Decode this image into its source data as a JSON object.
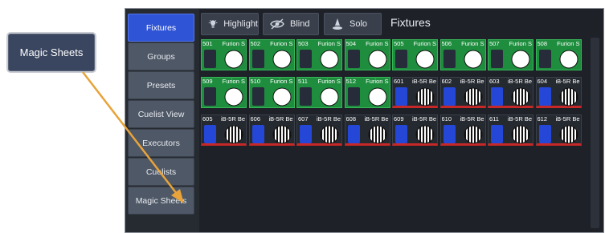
{
  "callout": {
    "label": "Magic Sheets"
  },
  "sidebar": {
    "items": [
      {
        "label": "Fixtures",
        "active": true
      },
      {
        "label": "Groups"
      },
      {
        "label": "Presets"
      },
      {
        "label": "Cuelist View"
      },
      {
        "label": "Executors"
      },
      {
        "label": "Cuelists"
      },
      {
        "label": "Magic Sheets"
      }
    ]
  },
  "toolbar": {
    "highlight_label": "Highlight",
    "blind_label": "Blind",
    "solo_label": "Solo",
    "title": "Fixtures"
  },
  "fixtures": [
    {
      "id": "501",
      "name": "Furion S",
      "type": "furion"
    },
    {
      "id": "502",
      "name": "Furion S",
      "type": "furion"
    },
    {
      "id": "503",
      "name": "Furion S",
      "type": "furion"
    },
    {
      "id": "504",
      "name": "Furion S",
      "type": "furion"
    },
    {
      "id": "505",
      "name": "Furion S",
      "type": "furion"
    },
    {
      "id": "506",
      "name": "Furion S",
      "type": "furion"
    },
    {
      "id": "507",
      "name": "Furion S",
      "type": "furion"
    },
    {
      "id": "508",
      "name": "Furion S",
      "type": "furion"
    },
    {
      "id": "509",
      "name": "Furion S",
      "type": "furion"
    },
    {
      "id": "510",
      "name": "Furion S",
      "type": "furion"
    },
    {
      "id": "511",
      "name": "Furion S",
      "type": "furion"
    },
    {
      "id": "512",
      "name": "Furion S",
      "type": "furion"
    },
    {
      "id": "601",
      "name": "iB-5R Be",
      "type": "ib"
    },
    {
      "id": "602",
      "name": "iB-5R Be",
      "type": "ib"
    },
    {
      "id": "603",
      "name": "iB-5R Be",
      "type": "ib"
    },
    {
      "id": "604",
      "name": "iB-5R Be",
      "type": "ib"
    },
    {
      "id": "605",
      "name": "iB-5R Be",
      "type": "ib"
    },
    {
      "id": "606",
      "name": "iB-5R Be",
      "type": "ib"
    },
    {
      "id": "607",
      "name": "iB-5R Be",
      "type": "ib"
    },
    {
      "id": "608",
      "name": "iB-5R Be",
      "type": "ib"
    },
    {
      "id": "609",
      "name": "iB-5R Be",
      "type": "ib"
    },
    {
      "id": "610",
      "name": "iB-5R Be",
      "type": "ib"
    },
    {
      "id": "611",
      "name": "iB-5R Be",
      "type": "ib"
    },
    {
      "id": "612",
      "name": "iB-5R Be",
      "type": "ib"
    }
  ],
  "colors": {
    "accent": "#2f54d6",
    "furion_tile": "#1e8e3e",
    "selected_bar": "#c62828",
    "arrow": "#e8a33a"
  },
  "icons": {
    "highlight": "lightbulb-icon",
    "blind": "eye-slash-icon",
    "solo": "spotlight-icon"
  }
}
